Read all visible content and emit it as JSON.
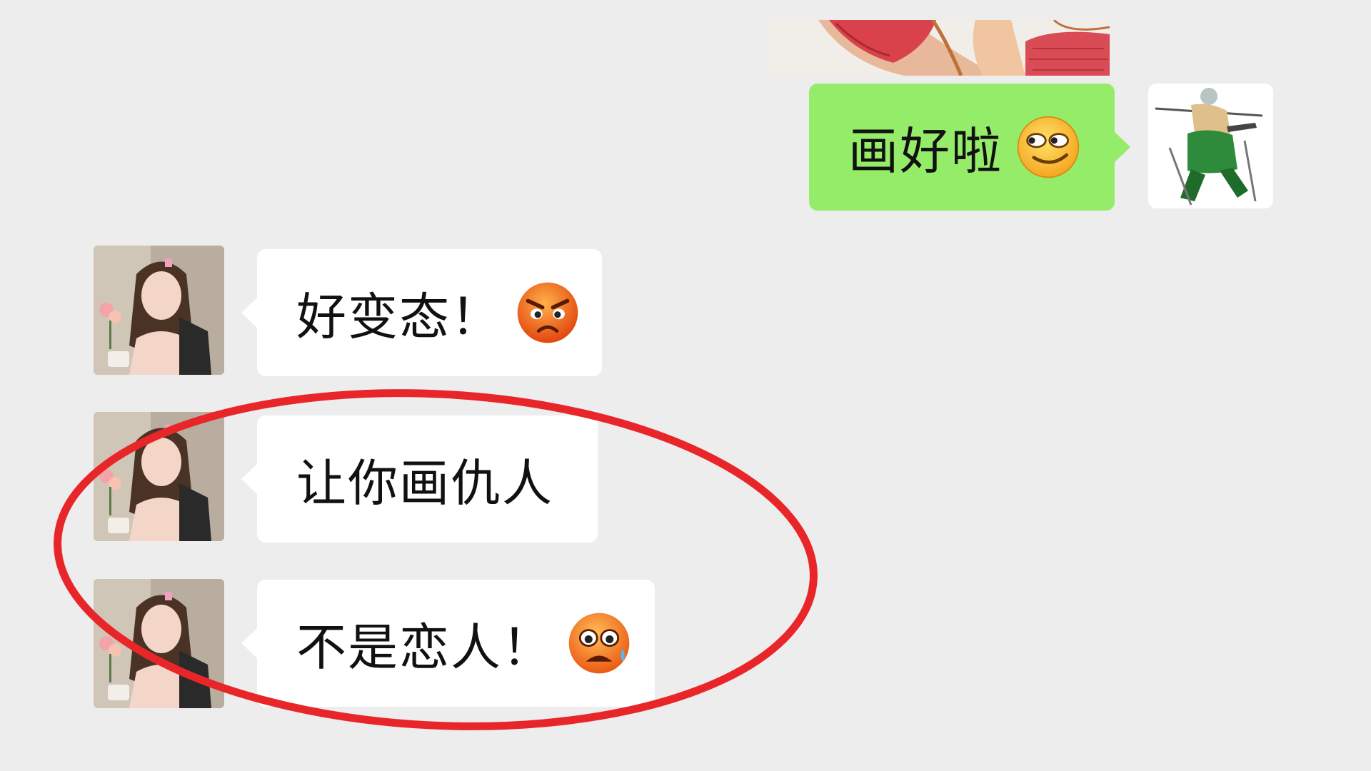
{
  "chat": {
    "messages": [
      {
        "sender": "self",
        "text": "画好啦",
        "emoji": "smirk-emoji"
      },
      {
        "sender": "friend",
        "text": "好变态！",
        "emoji": "angry-emoji"
      },
      {
        "sender": "friend",
        "text": "让你画仇人",
        "emoji": ""
      },
      {
        "sender": "friend",
        "text": "不是恋人！",
        "emoji": "anxious-sweat-emoji"
      }
    ]
  },
  "icons": {
    "self_avatar": "swordsman-avatar",
    "friend_avatar": "girl-photo-avatar",
    "top_image": "drawing-image"
  },
  "colors": {
    "background": "#ededed",
    "self_bubble": "#95ec69",
    "friend_bubble": "#ffffff",
    "highlight": "#e8262a"
  }
}
